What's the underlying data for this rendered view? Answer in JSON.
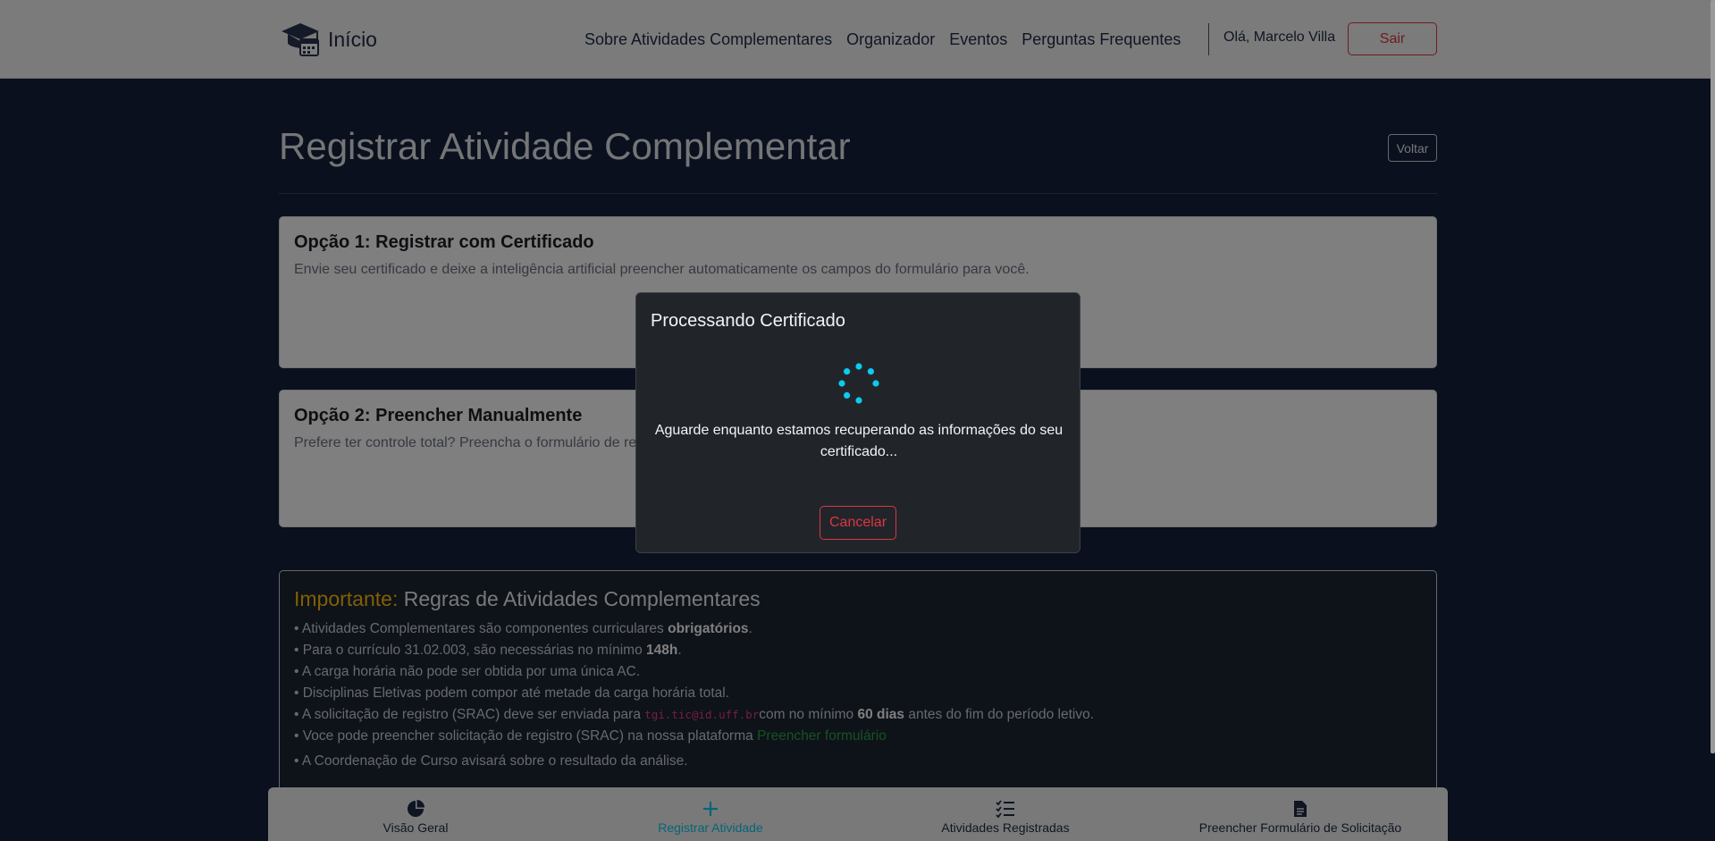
{
  "navbar": {
    "brand": "Início",
    "links": [
      "Sobre Atividades Complementares",
      "Organizador",
      "Eventos",
      "Perguntas Frequentes"
    ],
    "greeting": "Olá, Marcelo Villa",
    "logout_label": "Sair"
  },
  "main": {
    "title": "Registrar Atividade Complementar",
    "back_label": "Voltar",
    "option1": {
      "title": "Opção 1: Registrar com Certificado",
      "description": "Envie seu certificado e deixe a inteligência artificial preencher automaticamente os campos do formulário para você."
    },
    "option2": {
      "title": "Opção 2: Preencher Manualmente",
      "description": "Prefere ter controle total? Preencha o formulário de re"
    },
    "rules": {
      "heading_prefix": "Importante:",
      "heading": "Regras de Atividades Complementares",
      "r1_text": "• Atividades Complementares são componentes curriculares",
      "r1_bold": "obrigatórios",
      "r1_end": ".",
      "r2_text": "• Para o currículo 31.02.003, são necessárias no mínimo",
      "r2_bold": "148h",
      "r2_end": ".",
      "r3": "• A carga horária não pode ser obtida por uma única AC.",
      "r4": "• Disciplinas Eletivas podem compor até metade da carga horária total.",
      "r5_text": "• A solicitação de registro (SRAC) deve ser enviada para",
      "r5_email": "tgi.tic@id.uff.br",
      "r5_mid": "com no mínimo",
      "r5_bold": "60 dias",
      "r5_end": "antes do fim do período letivo.",
      "r6_text": "• Voce pode preencher solicitação de registro (SRAC) na nossa plataforma",
      "r6_link": "Preencher formulário",
      "r7": "• A Coordenação de Curso avisará sobre o resultado da análise."
    }
  },
  "bottom_nav": [
    {
      "label": "Visão Geral",
      "icon": "pie-chart-icon"
    },
    {
      "label": "Registrar Atividade",
      "icon": "plus-icon",
      "active": true
    },
    {
      "label": "Atividades Registradas",
      "icon": "list-check-icon"
    },
    {
      "label": "Preencher Formulário de Solicitação",
      "icon": "document-icon"
    }
  ],
  "modal": {
    "title": "Processando Certificado",
    "message": "Aguarde enquanto estamos recuperando as informações do seu certificado...",
    "cancel_label": "Cancelar"
  },
  "colors": {
    "background": "#15213a",
    "accent": "#0dcaf0",
    "danger": "#dc3545",
    "warning": "#ffc107",
    "success": "#28a745"
  }
}
